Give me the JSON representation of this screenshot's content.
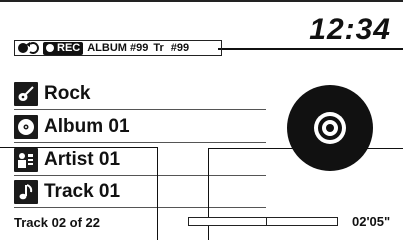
{
  "clock": {
    "time": "12:34"
  },
  "status_strip": {
    "mode_icon": "repeat-loop-icon",
    "rec_label": "REC",
    "album_label": "ALBUM #99",
    "track_label": "Tr",
    "track_value": "#99"
  },
  "info": {
    "genre": {
      "icon": "guitar-icon",
      "label": "Rock"
    },
    "album": {
      "icon": "disc-icon",
      "label": "Album 01"
    },
    "artist": {
      "icon": "artist-icon",
      "label": "Artist 01"
    },
    "track": {
      "icon": "music-note-icon",
      "label": "Track 01"
    }
  },
  "playback": {
    "position_text": "Track 02 of 22",
    "elapsed": "02'05\"",
    "progress_fraction": 0.52
  },
  "disc_icon": "cd-icon"
}
